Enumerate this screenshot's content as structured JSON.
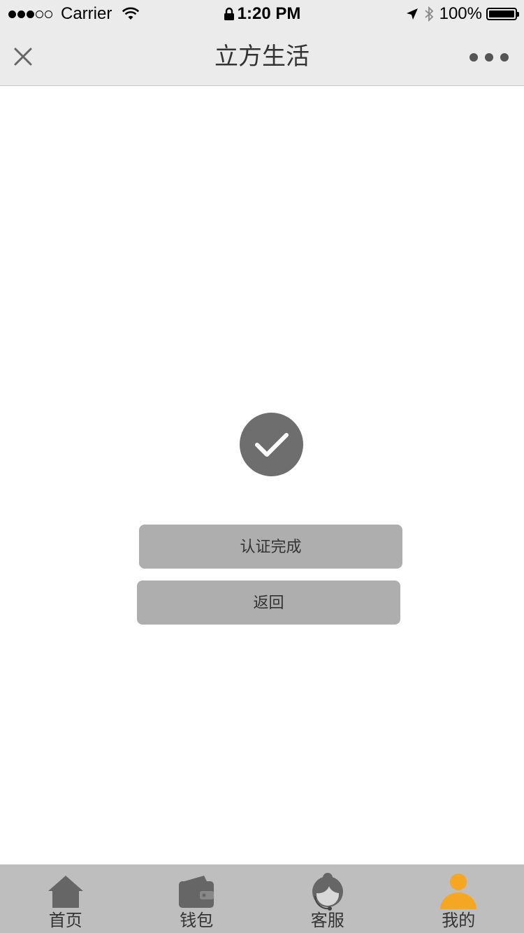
{
  "status_bar": {
    "carrier": "Carrier",
    "time": "1:20 PM",
    "battery": "100%"
  },
  "nav": {
    "title": "立方生活",
    "close_icon": "close-icon",
    "more_icon": "more-icon"
  },
  "main": {
    "success_icon": "check-circle-icon",
    "done_button": "认证完成",
    "back_button": "返回"
  },
  "tab_bar": {
    "tabs": [
      {
        "label": "首页",
        "icon": "home-icon"
      },
      {
        "label": "钱包",
        "icon": "wallet-icon"
      },
      {
        "label": "客服",
        "icon": "customer-service-icon"
      },
      {
        "label": "我的",
        "icon": "user-icon",
        "active": true
      }
    ]
  },
  "colors": {
    "bar_bg": "#ebebeb",
    "tab_bg": "#bebebe",
    "button_bg": "#aeaeae",
    "icon_gray": "#6e6e6e",
    "active_orange": "#f5a623"
  }
}
